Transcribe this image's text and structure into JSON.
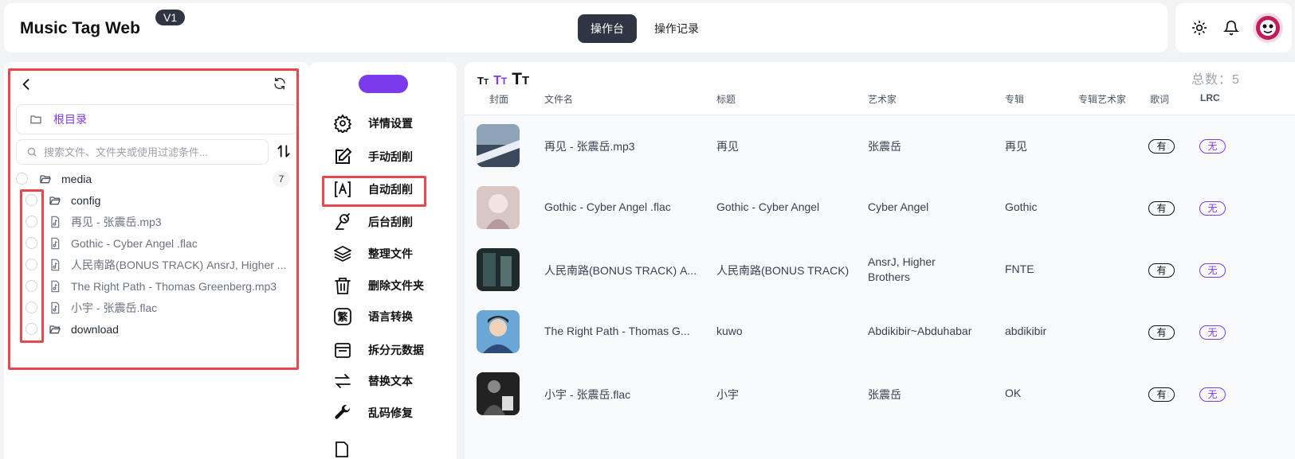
{
  "app": {
    "title": "Music Tag Web",
    "version": "V1"
  },
  "header": {
    "tabs": [
      "操作台",
      "操作记录"
    ],
    "active_tab": "操作台"
  },
  "header_icons": [
    "sun-icon",
    "bell-icon",
    "user-avatar"
  ],
  "file_panel": {
    "root_label": "根目录",
    "search_placeholder": "搜索文件、文件夹或使用过滤条件...",
    "tree": [
      {
        "type": "folder",
        "name": "media",
        "count": "7",
        "depth": 0
      },
      {
        "type": "folder",
        "name": "config",
        "depth": 1
      },
      {
        "type": "file",
        "name": "再见 - 张震岳.mp3",
        "depth": 1
      },
      {
        "type": "file",
        "name": "Gothic - Cyber Angel .flac",
        "depth": 1
      },
      {
        "type": "file",
        "name": "人民南路(BONUS TRACK) AnsrJ, Higher ...",
        "depth": 1
      },
      {
        "type": "file",
        "name": "The Right Path - Thomas Greenberg.mp3",
        "depth": 1
      },
      {
        "type": "file",
        "name": "小宇 - 张震岳.flac",
        "depth": 1
      },
      {
        "type": "folder",
        "name": "download",
        "depth": 1
      }
    ]
  },
  "toolbar": {
    "items": [
      {
        "label": "详情设置",
        "icon": "gear-icon"
      },
      {
        "label": "手动刮削",
        "icon": "edit-icon"
      },
      {
        "label": "自动刮削",
        "icon": "auto-a-icon"
      },
      {
        "label": "后台刮削",
        "icon": "satellite-icon"
      },
      {
        "label": "整理文件",
        "icon": "layers-icon"
      },
      {
        "label": "删除文件夹",
        "icon": "trash-icon"
      },
      {
        "label": "语言转换",
        "icon": "traditional-char-icon"
      },
      {
        "label": "拆分元数据",
        "icon": "split-icon"
      },
      {
        "label": "替换文本",
        "icon": "swap-icon"
      },
      {
        "label": "乱码修复",
        "icon": "wrench-icon"
      }
    ]
  },
  "table": {
    "total": "总数：5",
    "headers": [
      "封面",
      "文件名",
      "标题",
      "艺术家",
      "专辑",
      "专辑艺术家",
      "歌词",
      "LRC"
    ],
    "rows": [
      {
        "filename": "再见 - 张震岳.mp3",
        "title": "再见",
        "artist": "张震岳",
        "album": "再见",
        "album_artist": "",
        "lyrics": "有",
        "lrc": "无"
      },
      {
        "filename": "Gothic - Cyber Angel .flac",
        "title": "Gothic - Cyber Angel",
        "artist": "Cyber Angel",
        "album": "Gothic",
        "album_artist": "",
        "lyrics": "有",
        "lrc": "无"
      },
      {
        "filename": "人民南路(BONUS TRACK) A...",
        "title": "人民南路(BONUS TRACK)",
        "artist": "AnsrJ, Higher Brothers",
        "album": "FNTE",
        "album_artist": "",
        "lyrics": "有",
        "lrc": "无"
      },
      {
        "filename": "The Right Path - Thomas G...",
        "title": "kuwo",
        "artist": "Abdikibir~Abduhabar",
        "album": "abdikibir",
        "album_artist": "",
        "lyrics": "有",
        "lrc": "无"
      },
      {
        "filename": "小宇 - 张震岳.flac",
        "title": "小宇",
        "artist": "张震岳",
        "album": "OK",
        "album_artist": "",
        "lyrics": "有",
        "lrc": "无"
      }
    ]
  },
  "colors": {
    "accent": "#7c3aed",
    "highlight": "#e5484d",
    "dark": "#2f3542"
  }
}
